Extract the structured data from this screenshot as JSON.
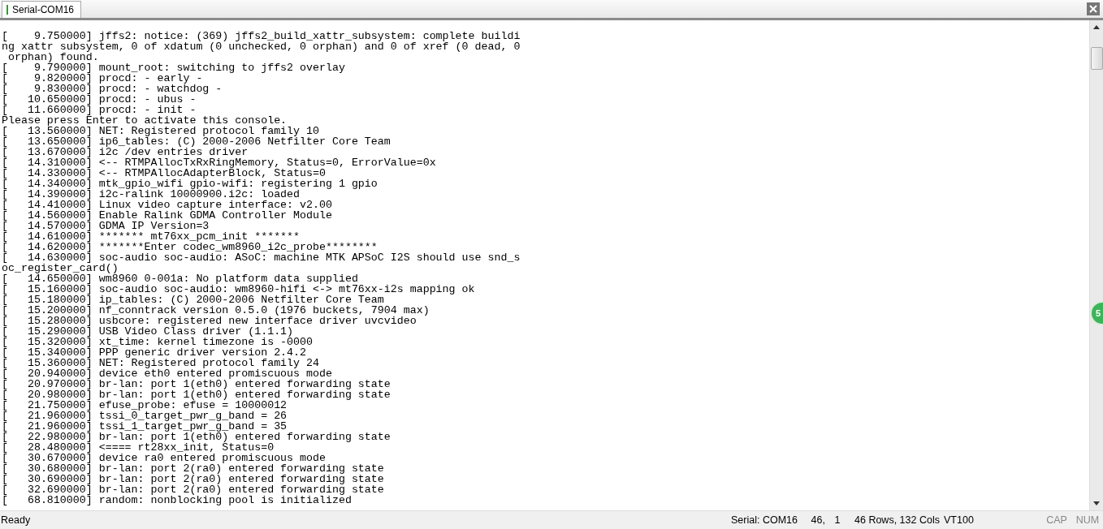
{
  "tabs": [
    {
      "label": "Serial-COM16",
      "selected": true
    }
  ],
  "terminal": {
    "lines": [
      "[    9.750000] jffs2: notice: (369) jffs2_build_xattr_subsystem: complete buildi",
      "ng xattr subsystem, 0 of xdatum (0 unchecked, 0 orphan) and 0 of xref (0 dead, 0",
      " orphan) found.",
      "[    9.790000] mount_root: switching to jffs2 overlay",
      "[    9.820000] procd: - early -",
      "[    9.830000] procd: - watchdog -",
      "[   10.650000] procd: - ubus -",
      "[   11.660000] procd: - init -",
      "Please press Enter to activate this console.",
      "[   13.560000] NET: Registered protocol family 10",
      "[   13.650000] ip6_tables: (C) 2000-2006 Netfilter Core Team",
      "[   13.670000] i2c /dev entries driver",
      "[   14.310000] <-- RTMPAllocTxRxRingMemory, Status=0, ErrorValue=0x",
      "[   14.330000] <-- RTMPAllocAdapterBlock, Status=0",
      "[   14.340000] mtk_gpio_wifi gpio-wifi: registering 1 gpio",
      "[   14.390000] i2c-ralink 10000900.i2c: loaded",
      "[   14.410000] Linux video capture interface: v2.00",
      "[   14.560000] Enable Ralink GDMA Controller Module",
      "[   14.570000] GDMA IP Version=3",
      "[   14.610000] ******* mt76xx_pcm_init *******",
      "[   14.620000] *******Enter codec_wm8960_i2c_probe********",
      "[   14.630000] soc-audio soc-audio: ASoC: machine MTK APSoC I2S should use snd_s",
      "oc_register_card()",
      "[   14.650000] wm8960 0-001a: No platform data supplied",
      "[   15.160000] soc-audio soc-audio: wm8960-hifi <-> mt76xx-i2s mapping ok",
      "[   15.180000] ip_tables: (C) 2000-2006 Netfilter Core Team",
      "[   15.200000] nf_conntrack version 0.5.0 (1976 buckets, 7904 max)",
      "[   15.280000] usbcore: registered new interface driver uvcvideo",
      "[   15.290000] USB Video Class driver (1.1.1)",
      "[   15.320000] xt_time: kernel timezone is -0000",
      "[   15.340000] PPP generic driver version 2.4.2",
      "[   15.360000] NET: Registered protocol family 24",
      "[   20.940000] device eth0 entered promiscuous mode",
      "[   20.970000] br-lan: port 1(eth0) entered forwarding state",
      "[   20.980000] br-lan: port 1(eth0) entered forwarding state",
      "[   21.750000] efuse_probe: efuse = 10000012",
      "[   21.960000] tssi_0_target_pwr_g_band = 26",
      "[   21.960000] tssi_1_target_pwr_g_band = 35",
      "[   22.980000] br-lan: port 1(eth0) entered forwarding state",
      "[   28.480000] <==== rt28xx_init, Status=0",
      "[   30.670000] device ra0 entered promiscuous mode",
      "[   30.680000] br-lan: port 2(ra0) entered forwarding state",
      "[   30.690000] br-lan: port 2(ra0) entered forwarding state",
      "[   32.690000] br-lan: port 2(ra0) entered forwarding state",
      "[   68.810000] random: nonblocking pool is initialized"
    ]
  },
  "floating_badge": {
    "label": "5"
  },
  "status_bar": {
    "status": "Ready",
    "connection": "Serial: COM16",
    "cursor_row": "46,",
    "cursor_col": "1",
    "size": "46 Rows, 132 Cols",
    "emulation": "VT100",
    "indicators": [
      "CAP",
      "NUM"
    ]
  }
}
